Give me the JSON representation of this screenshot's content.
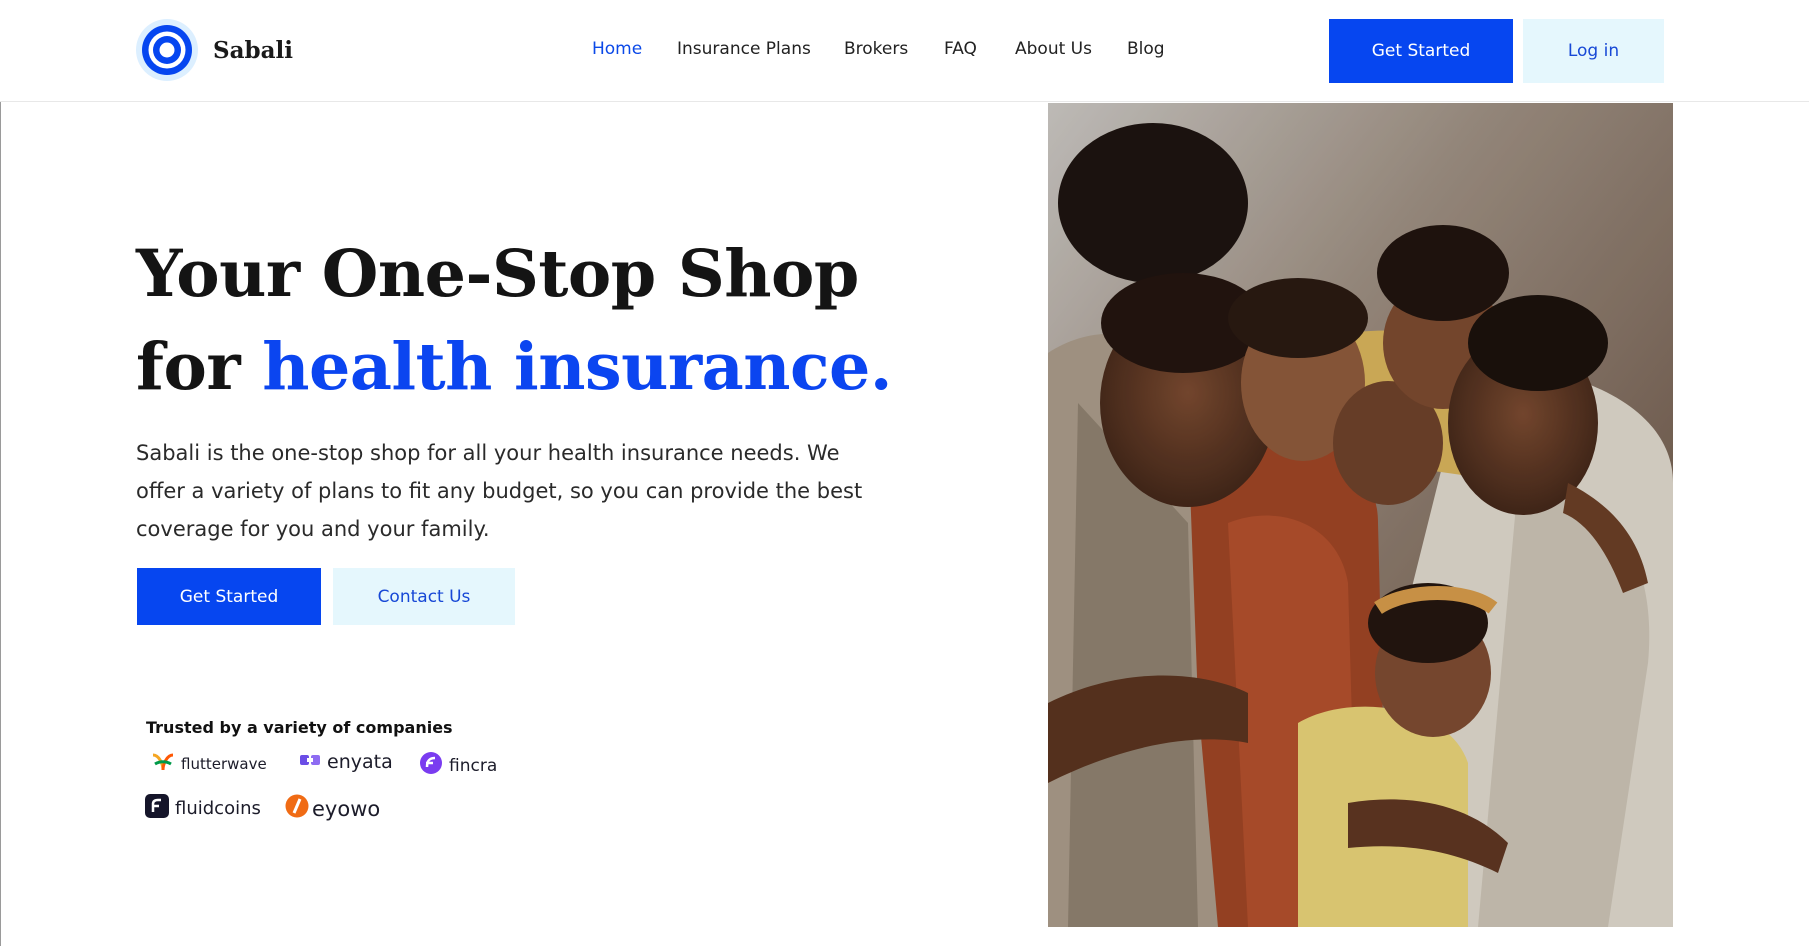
{
  "brand": {
    "name": "Sabali",
    "accent": "#0646f0",
    "light_button": "#e5f7fd"
  },
  "nav": {
    "items": [
      {
        "label": "Home",
        "active": true
      },
      {
        "label": "Insurance Plans",
        "active": false
      },
      {
        "label": "Brokers",
        "active": false
      },
      {
        "label": "FAQ",
        "active": false
      },
      {
        "label": "About Us",
        "active": false
      },
      {
        "label": "Blog",
        "active": false
      }
    ],
    "get_started": "Get Started",
    "login": "Log in"
  },
  "hero": {
    "title_line1": "Your One-Stop Shop",
    "title_for": "for ",
    "title_accent": "health insurance.",
    "body": "Sabali is the one-stop shop for all your health insurance needs. We offer a variety of plans to fit any budget, so you can provide the best coverage for you and your family.",
    "primary_cta": "Get Started",
    "secondary_cta": "Contact Us"
  },
  "trusted": {
    "heading": "Trusted by a variety of companies",
    "companies": [
      "flutterwave",
      "enyata",
      "fincra",
      "fluidcoins",
      "eyowo"
    ]
  },
  "photo": {
    "icon": "family-photo"
  }
}
